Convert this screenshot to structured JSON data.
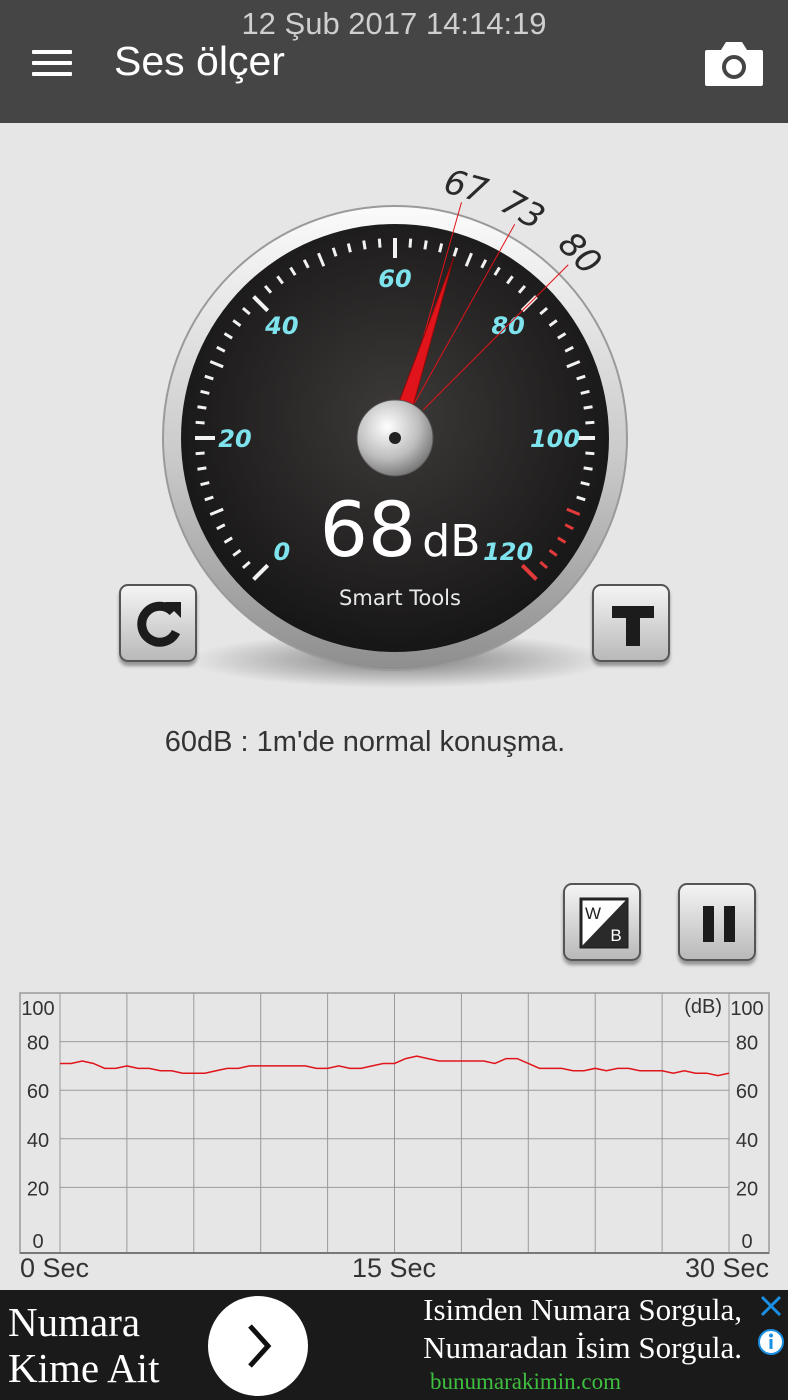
{
  "status": {
    "datetime": "12 Şub 2017 14:14:19"
  },
  "app_bar": {
    "title": "Ses ölçer",
    "menu_icon": "menu-icon",
    "camera_icon": "camera-icon"
  },
  "gauge": {
    "value": 68,
    "value_text": "68",
    "unit": "dB",
    "min": 0,
    "max": 120,
    "scale_labels": [
      "0",
      "20",
      "40",
      "60",
      "80",
      "100",
      "120"
    ],
    "markers": [
      67,
      73,
      80
    ],
    "marker_labels": [
      "67",
      "73",
      "80"
    ],
    "brand": "Smart Tools",
    "label_color": "#7fe3ee",
    "needle_color": "#e0141a"
  },
  "buttons": {
    "reset_icon": "refresh-icon",
    "text_icon": "text-t-icon",
    "wb_icon": "white-black-icon",
    "wb_letters": [
      "W",
      "B"
    ],
    "pause_icon": "pause-icon"
  },
  "info_text": "60dB : 1m'de normal konuşma.",
  "chart_data": {
    "type": "line",
    "ylim": [
      0,
      100
    ],
    "y_ticks_left": [
      "100",
      "80",
      "60",
      "40",
      "20",
      "0"
    ],
    "y_ticks_right": [
      "100",
      "80",
      "60",
      "40",
      "20",
      "0"
    ],
    "y_unit": "(dB)",
    "x_ticks": [
      "0 Sec",
      "15 Sec",
      "30 Sec"
    ],
    "xlim": [
      0,
      30
    ],
    "grid": true,
    "series": [
      {
        "color": "#e0141a",
        "x": [
          0,
          0.5,
          1,
          1.5,
          2,
          2.5,
          3,
          3.5,
          4,
          4.5,
          5,
          5.5,
          6,
          6.5,
          7,
          7.5,
          8,
          8.5,
          9,
          9.5,
          10,
          10.5,
          11,
          11.5,
          12,
          12.5,
          13,
          13.5,
          14,
          14.5,
          15,
          15.5,
          16,
          16.5,
          17,
          17.5,
          18,
          18.5,
          19,
          19.5,
          20,
          20.5,
          21,
          21.5,
          22,
          22.5,
          23,
          23.5,
          24,
          24.5,
          25,
          25.5,
          26,
          26.5,
          27,
          27.5,
          28,
          28.5,
          29,
          29.5,
          30
        ],
        "values": [
          71,
          71,
          72,
          71,
          69,
          69,
          70,
          69,
          69,
          68,
          68,
          67,
          67,
          67,
          68,
          69,
          69,
          70,
          70,
          70,
          70,
          70,
          70,
          69,
          69,
          70,
          69,
          69,
          70,
          71,
          71,
          73,
          74,
          73,
          72,
          72,
          72,
          72,
          72,
          71,
          73,
          73,
          71,
          69,
          69,
          69,
          68,
          68,
          69,
          68,
          69,
          69,
          68,
          68,
          68,
          67,
          68,
          67,
          67,
          66,
          67
        ]
      }
    ]
  },
  "ad": {
    "left_lines": [
      "Numara",
      "Kime Ait"
    ],
    "right_lines": [
      "Isimden Numara Sorgula,",
      "Numaradan İsim Sorgula."
    ],
    "url": "bunumarakimin.com",
    "arrow_icon": "chevron-right-icon",
    "close_icon": "close-icon",
    "info_icon": "info-icon"
  }
}
